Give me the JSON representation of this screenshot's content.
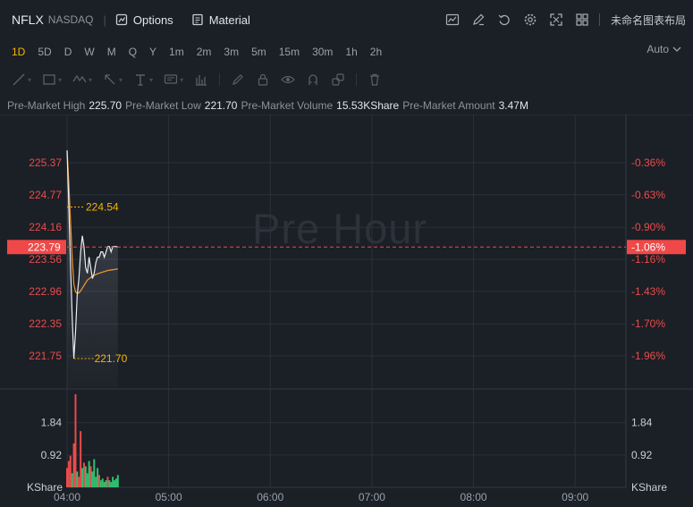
{
  "header": {
    "ticker": "NFLX",
    "exchange": "NASDAQ",
    "options_label": "Options",
    "material_label": "Material",
    "layout_name": "未命名图表布局",
    "tool_icons": [
      "indicator-chart-icon",
      "draw-pen-icon",
      "undo-icon",
      "settings-gear-icon",
      "fullscreen-icon",
      "grid-layout-icon"
    ]
  },
  "intervals": {
    "items": [
      "1D",
      "5D",
      "D",
      "W",
      "M",
      "Q",
      "Y",
      "1m",
      "2m",
      "3m",
      "5m",
      "15m",
      "30m",
      "1h",
      "2h"
    ],
    "active": "1D",
    "auto_label": "Auto"
  },
  "drawing_tools": [
    "line-tool-icon",
    "rectangle-tool-icon",
    "waves-tool-icon",
    "arrow-tool-icon",
    "text-tool-icon",
    "note-tool-icon",
    "measure-tool-icon",
    "brush-icon",
    "lock-icon",
    "eye-icon",
    "magnet-icon",
    "link-icon",
    "trash-icon"
  ],
  "info": {
    "high_label": "Pre-Market High",
    "high_value": "225.70",
    "low_label": "Pre-Market Low",
    "low_value": "221.70",
    "volume_label": "Pre-Market Volume",
    "volume_value": "15.53KShare",
    "amount_label": "Pre-Market Amount",
    "amount_value": "3.47M"
  },
  "colors": {
    "up": "#e84c4c",
    "down": "#2fbf71",
    "accent": "#f3b600",
    "price_line": "#e9edf2",
    "avg_line": "#e8912d",
    "grid": "#2b313a",
    "price_tag_bg": "#f04848"
  },
  "chart_data": {
    "type": "line",
    "watermark": "Pre Hour",
    "current_price": 223.79,
    "current_price_label": "223.79",
    "current_pct_label": "-1.06%",
    "high_annotation": "224.54",
    "low_annotation": "221.70",
    "ylim": [
      221.3,
      225.7
    ],
    "y_ticks": [
      {
        "value": 225.37,
        "label": "225.37",
        "pct": "-0.36%"
      },
      {
        "value": 224.77,
        "label": "224.77",
        "pct": "-0.63%"
      },
      {
        "value": 224.16,
        "label": "224.16",
        "pct": "-0.90%"
      },
      {
        "value": 223.56,
        "label": "223.56",
        "pct": "-1.16%"
      },
      {
        "value": 222.96,
        "label": "222.96",
        "pct": "-1.43%"
      },
      {
        "value": 222.35,
        "label": "222.35",
        "pct": "-1.70%"
      },
      {
        "value": 221.75,
        "label": "221.75",
        "pct": "-1.96%"
      }
    ],
    "x_ticks": [
      {
        "label": "04:00",
        "minute": 0
      },
      {
        "label": "05:00",
        "minute": 60
      },
      {
        "label": "06:00",
        "minute": 120
      },
      {
        "label": "07:00",
        "minute": 180
      },
      {
        "label": "08:00",
        "minute": 240
      },
      {
        "label": "09:00",
        "minute": 300
      }
    ],
    "x_range_minutes": [
      0,
      330
    ],
    "series": [
      {
        "name": "",
        "minutes": [
          0,
          1,
          2,
          3,
          4,
          5,
          6,
          7,
          8,
          9,
          10,
          11,
          12,
          13,
          14,
          15,
          16,
          17,
          18,
          19,
          20,
          21,
          22,
          23,
          24,
          25,
          26,
          27,
          28,
          29,
          30
        ],
        "values": [
          225.6,
          224.6,
          223.5,
          222.5,
          221.7,
          222.2,
          222.9,
          223.2,
          223.7,
          224.0,
          223.8,
          223.4,
          223.3,
          223.6,
          223.4,
          223.2,
          223.3,
          223.5,
          223.6,
          223.6,
          223.7,
          223.7,
          223.6,
          223.7,
          223.8,
          223.8,
          223.7,
          223.8,
          223.8,
          223.8,
          223.79
        ]
      },
      {
        "name": "",
        "minutes": [
          0,
          1,
          2,
          3,
          4,
          5,
          6,
          7,
          8,
          9,
          10,
          11,
          12,
          14,
          16,
          18,
          20,
          22,
          24,
          26,
          28,
          30
        ],
        "values": [
          225.6,
          225.0,
          224.3,
          223.6,
          223.1,
          222.95,
          222.92,
          222.93,
          222.97,
          223.02,
          223.07,
          223.12,
          223.17,
          223.22,
          223.26,
          223.29,
          223.31,
          223.33,
          223.35,
          223.36,
          223.37,
          223.38
        ]
      }
    ],
    "volume": {
      "unit_label": "KShare",
      "ylim": [
        0,
        2.8
      ],
      "ticks": [
        {
          "value": 1.84,
          "label": "1.84"
        },
        {
          "value": 0.92,
          "label": "0.92"
        }
      ],
      "bars": [
        {
          "minute": 0,
          "value": 0.55,
          "dir": "down"
        },
        {
          "minute": 1,
          "value": 0.75,
          "dir": "down"
        },
        {
          "minute": 2,
          "value": 0.9,
          "dir": "down"
        },
        {
          "minute": 3,
          "value": 0.4,
          "dir": "up"
        },
        {
          "minute": 4,
          "value": 1.25,
          "dir": "down"
        },
        {
          "minute": 5,
          "value": 2.65,
          "dir": "down"
        },
        {
          "minute": 6,
          "value": 0.45,
          "dir": "up"
        },
        {
          "minute": 7,
          "value": 0.3,
          "dir": "down"
        },
        {
          "minute": 8,
          "value": 1.6,
          "dir": "down"
        },
        {
          "minute": 9,
          "value": 0.55,
          "dir": "up"
        },
        {
          "minute": 10,
          "value": 0.7,
          "dir": "down"
        },
        {
          "minute": 11,
          "value": 0.6,
          "dir": "up"
        },
        {
          "minute": 12,
          "value": 0.4,
          "dir": "up"
        },
        {
          "minute": 13,
          "value": 0.75,
          "dir": "up"
        },
        {
          "minute": 14,
          "value": 0.6,
          "dir": "down"
        },
        {
          "minute": 15,
          "value": 0.45,
          "dir": "up"
        },
        {
          "minute": 16,
          "value": 0.8,
          "dir": "up"
        },
        {
          "minute": 17,
          "value": 0.3,
          "dir": "up"
        },
        {
          "minute": 18,
          "value": 0.55,
          "dir": "up"
        },
        {
          "minute": 19,
          "value": 0.35,
          "dir": "down"
        },
        {
          "minute": 20,
          "value": 0.2,
          "dir": "up"
        },
        {
          "minute": 21,
          "value": 0.25,
          "dir": "up"
        },
        {
          "minute": 22,
          "value": 0.15,
          "dir": "up"
        },
        {
          "minute": 23,
          "value": 0.2,
          "dir": "up"
        },
        {
          "minute": 24,
          "value": 0.3,
          "dir": "down"
        },
        {
          "minute": 25,
          "value": 0.2,
          "dir": "up"
        },
        {
          "minute": 26,
          "value": 0.15,
          "dir": "up"
        },
        {
          "minute": 27,
          "value": 0.3,
          "dir": "up"
        },
        {
          "minute": 28,
          "value": 0.2,
          "dir": "up"
        },
        {
          "minute": 29,
          "value": 0.25,
          "dir": "up"
        },
        {
          "minute": 30,
          "value": 0.35,
          "dir": "up"
        }
      ]
    }
  }
}
